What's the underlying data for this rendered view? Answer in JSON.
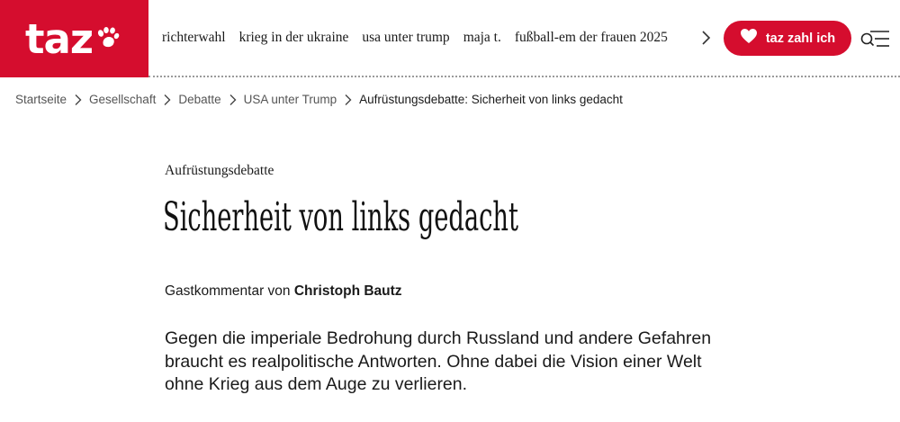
{
  "header": {
    "logo_text": "taz",
    "nav_items": [
      "richterwahl",
      "krieg in der ukraine",
      "usa unter trump",
      "maja t.",
      "fußball-em der frauen 2025"
    ],
    "support_button_label": "taz zahl ich",
    "brand_color": "#d50d2e"
  },
  "breadcrumb": {
    "items": [
      "Startseite",
      "Gesellschaft",
      "Debatte",
      "USA unter Trump"
    ],
    "current": "Aufrüstungsdebatte: Sicherheit von links gedacht"
  },
  "article": {
    "kicker": "Aufrüstungsdebatte",
    "title": "Sicherheit von links gedacht",
    "byline_prefix": "Gastkommentar von ",
    "author": "Christoph Bautz",
    "teaser": "Gegen die imperiale Bedrohung durch Russland und andere Gefahren braucht es realpolitische Antworten. Ohne dabei die Vision einer Welt ohne Krieg aus dem Auge zu verlieren."
  }
}
